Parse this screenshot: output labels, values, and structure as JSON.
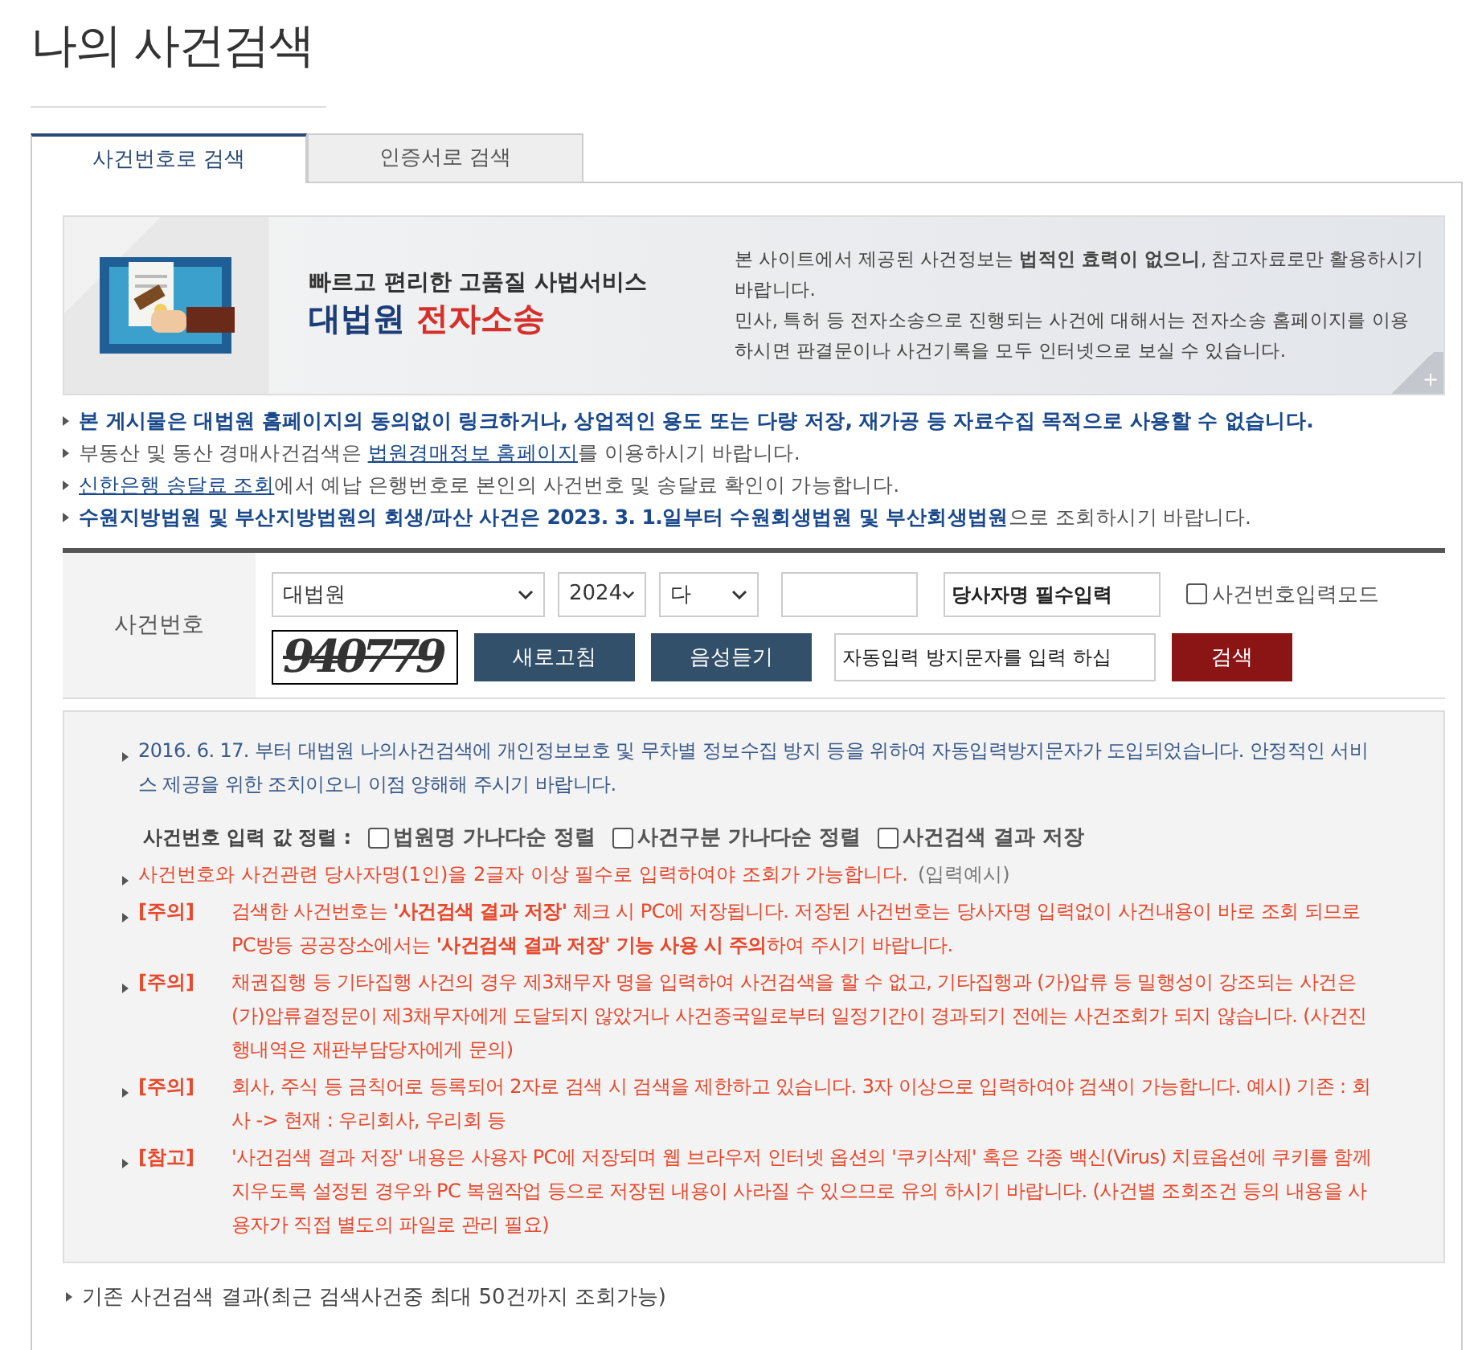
{
  "page_title": "나의 사건검색",
  "tabs": [
    {
      "label": "사건번호로 검색",
      "selected": true
    },
    {
      "label": "인증서로 검색",
      "selected": false
    }
  ],
  "banner": {
    "kind": "picture",
    "headline": "빠르고 편리한 고품질 사법서비스",
    "brand_main": "대법원",
    "brand_accent": "전자소송",
    "notice": "본 사이트에서 제공된 사건정보는 **법적인 효력이 없으니**, 참고자료로만 활용하시기 바랍니다.\n민사, 특허 등 전자소송으로 진행되는 사건에 대해서는 전자소송 홈페이지를 이용하시면 판결문이나 사건기록을 모두 인터넷으로 보실 수 있습니다.",
    "more": "+"
  },
  "notices": [
    {
      "parts": [
        {
          "kind": "strong",
          "text": "본 게시물은 대법원 홈페이지의 동의없이 링크하거나, 상업적인 용도 또는 다량 저장, 재가공 등 자료수집 목적으로 사용할 수 없습니다."
        }
      ]
    },
    {
      "parts": [
        {
          "kind": "text",
          "text": "부동산 및 동산 경매사건검색은 "
        },
        {
          "kind": "link",
          "text": "법원경매정보 홈페이지"
        },
        {
          "kind": "text",
          "text": "를 이용하시기 바랍니다."
        }
      ]
    },
    {
      "parts": [
        {
          "kind": "link",
          "text": "신한은행 송달료 조회"
        },
        {
          "kind": "text",
          "text": "에서 예납 은행번호로 본인의 사건번호 및 송달료 확인이 가능합니다."
        }
      ]
    },
    {
      "parts": [
        {
          "kind": "strong",
          "text": "수원지방법원 및 부산지방법원의 회생/파산 사건은 2023. 3. 1.일부터 수원회생법원 및 부산회생법원"
        },
        {
          "kind": "text",
          "text": "으로 조회하시기 바랍니다."
        }
      ]
    }
  ],
  "form": {
    "label": "사건번호",
    "court": "대법원",
    "year": "2024",
    "case_type": "다",
    "party_placeholder": "당사자명 필수입력",
    "input_mode": {
      "label": "사건번호입력모드",
      "checked": false
    },
    "captcha": "940779",
    "refresh": "새로고침",
    "listen": "음성듣기",
    "captcha_placeholder": "자동입력 방지문자를 입력 하십",
    "search": "검색"
  },
  "info": {
    "intro": "2016. 6. 17. 부터 대법원 나의사건검색에 개인정보보호 및 무차별 정보수집 방지 등을 위하여 자동입력방지문자가 도입되었습니다. 안정적인 서비스 제공을 위한 조치이오니 이점 양해해 주시기 바랍니다.",
    "sort_label": "사건번호 입력 값 정렬 :",
    "options": [
      {
        "label": "법원명 가나다순 정렬",
        "checked": false
      },
      {
        "label": "사건구분 가나다순 정렬",
        "checked": false
      },
      {
        "label": "사건검색 결과 저장",
        "checked": false
      }
    ],
    "required_text": "사건번호와 사건관련 당사자명(1인)을 2글자 이상 필수로 입력하여야 조회가 가능합니다.",
    "example": "(입력예시)",
    "notes": [
      {
        "tag": "[주의]",
        "text": "검색한 사건번호는 **'사건검색 결과 저장'** 체크 시 PC에 저장됩니다. 저장된 사건번호는 당사자명 입력없이 사건내용이 바로 조회 되므로 PC방등 공공장소에서는 **'사건검색 결과 저장' 기능 사용 시 주의**하여 주시기 바랍니다."
      },
      {
        "tag": "[주의]",
        "text": "채권집행 등 기타집행 사건의 경우 제3채무자 명을 입력하여 사건검색을 할 수 없고, 기타집행과 (가)압류 등 밀행성이 강조되는 사건은 (가)압류결정문이 제3채무자에게 도달되지 않았거나 사건종국일로부터 일정기간이 경과되기 전에는 사건조회가 되지 않습니다. (사건진행내역은 재판부담당자에게 문의)"
      },
      {
        "tag": "[주의]",
        "text": "회사, 주식 등 금칙어로 등록되어 2자로 검색 시 검색을 제한하고 있습니다. 3자 이상으로 입력하여야 검색이 가능합니다. 예시) 기존 : 회사 -> 현재 : 우리회사, 우리회 등"
      },
      {
        "tag": "[참고]",
        "text": "'사건검색 결과 저장' 내용은 사용자 PC에 저장되며 웹 브라우저 인터넷 옵션의 '쿠키삭제' 혹은 각종 백신(Virus) 치료옵션에 쿠키를 함께 지우도록 설정된 경우와 PC 복원작업 등으로 저장된 내용이 사라질 수 있으므로 유의 하시기 바랍니다. (사건별 조회조건 등의 내용을 사용자가 직접 별도의 파일로 관리 필요)"
      }
    ]
  },
  "history": "기존 사건검색 결과(최근 검색사건중 최대 50건까지 조회가능)"
}
